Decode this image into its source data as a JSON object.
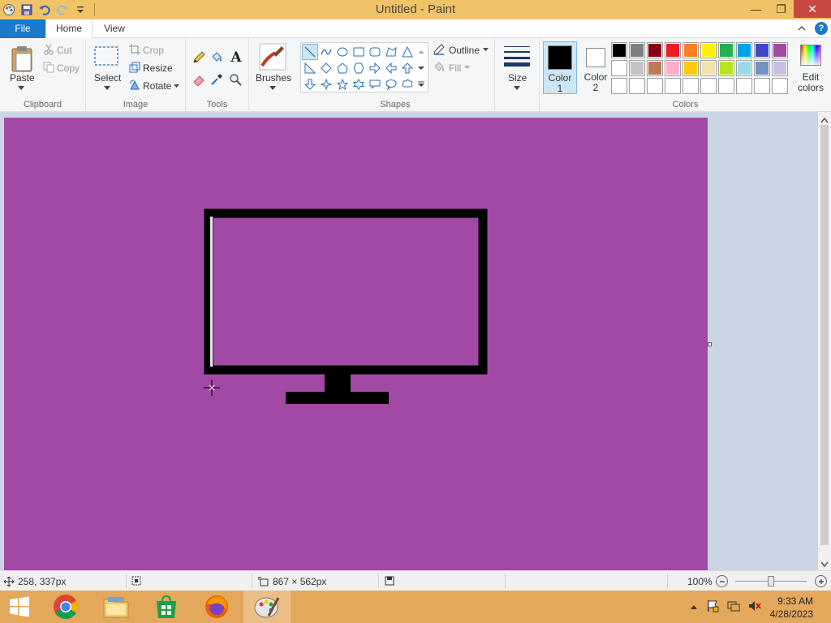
{
  "window": {
    "title": "Untitled - Paint",
    "minimize_glyph": "—",
    "maximize_glyph": "❐",
    "close_glyph": "✕"
  },
  "tabs": {
    "file": "File",
    "home": "Home",
    "view": "View",
    "help_glyph": "?"
  },
  "ribbon": {
    "clipboard": {
      "group_label": "Clipboard",
      "paste": "Paste",
      "cut": "Cut",
      "copy": "Copy"
    },
    "image": {
      "group_label": "Image",
      "select": "Select",
      "crop": "Crop",
      "resize": "Resize",
      "rotate": "Rotate"
    },
    "tools": {
      "group_label": "Tools",
      "text_glyph": "A"
    },
    "brushes": {
      "label": "Brushes"
    },
    "shapes": {
      "group_label": "Shapes",
      "outline": "Outline",
      "fill": "Fill"
    },
    "size": {
      "label": "Size"
    },
    "colors": {
      "group_label": "Colors",
      "color1_label_line1": "Color",
      "color1_label_line2": "1",
      "color2_label_line1": "Color",
      "color2_label_line2": "2",
      "edit_colors_line1": "Edit",
      "edit_colors_line2": "colors",
      "color1": "#000000",
      "color2": "#ffffff",
      "palette_row1": [
        "#000000",
        "#7f7f7f",
        "#880015",
        "#ed1c24",
        "#ff7f27",
        "#fff200",
        "#22b14c",
        "#00a2e8",
        "#3f48cc",
        "#a349a4"
      ],
      "palette_row2": [
        "#ffffff",
        "#c3c3c3",
        "#b97a57",
        "#ffaec9",
        "#ffc90e",
        "#efe4b0",
        "#b5e61d",
        "#99d9ea",
        "#7092be",
        "#c8bfe7"
      ],
      "palette_row3": [
        "#ffffff",
        "#ffffff",
        "#ffffff",
        "#ffffff",
        "#ffffff",
        "#ffffff",
        "#ffffff",
        "#ffffff",
        "#ffffff",
        "#ffffff"
      ]
    }
  },
  "canvas": {
    "background_color": "#a149a4",
    "drawing_color": "#000000"
  },
  "statusbar": {
    "cursor_position": "258, 337px",
    "image_size": "867 × 562px",
    "zoom": "100%"
  },
  "taskbar": {
    "apps": [
      "start-button",
      "chrome-app",
      "file-explorer-app",
      "store-app",
      "firefox-app",
      "paint-app"
    ],
    "time": "9:33 AM",
    "date": "4/28/2023"
  }
}
